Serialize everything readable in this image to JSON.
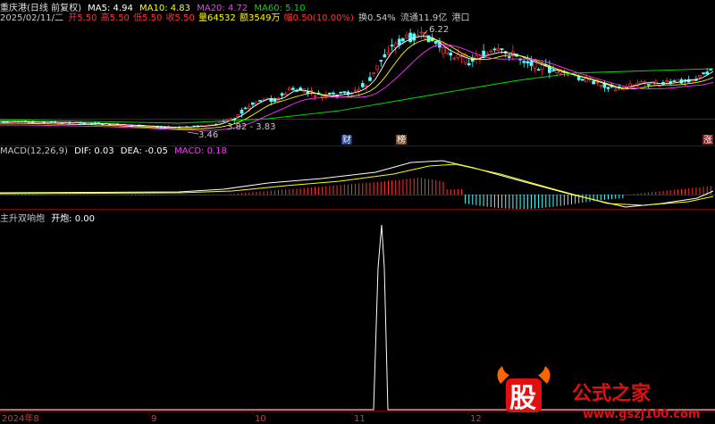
{
  "header": {
    "title": "重庆港(日线 前复权)",
    "ma": [
      {
        "label": "MA5: 4.94",
        "color": "#ffffff"
      },
      {
        "label": "MA10: 4.83",
        "color": "#ffff00"
      },
      {
        "label": "MA20: 4.72",
        "color": "#ff33ff"
      },
      {
        "label": "MA60: 5.10",
        "color": "#00e000"
      }
    ],
    "date": "2025/02/11/二",
    "open": "开5.50",
    "high": "高5.50",
    "low": "低5.50",
    "close": "收5.50",
    "volume": "量64532",
    "amount": "额3549万",
    "range": "幅0.50(10.00%)",
    "turnover": "换0.54%",
    "float": "流通11.9亿",
    "sector": "港口"
  },
  "price_annotations": {
    "high_label": "6.22",
    "low_label": "3.46",
    "mid_label": "3.82 - 3.83",
    "markers": [
      "财",
      "榜",
      "涨"
    ]
  },
  "macd": {
    "title": "MACD(12,26,9)",
    "dif": "DIF: 0.03",
    "dea": "DEA: -0.05",
    "macd": "MACD: 0.18"
  },
  "indicator": {
    "title": "主升双响炮",
    "value": "开炮: 0.00"
  },
  "x_axis": [
    "2024年8",
    "9",
    "10",
    "11",
    "12"
  ],
  "watermark": {
    "icon_text": "股",
    "brand": "公式之家",
    "url": "www.gszj100.com"
  },
  "colors": {
    "up": "#ff3333",
    "down": "#54ffff",
    "ma5": "#ffffff",
    "ma10": "#ffff00",
    "ma20": "#ff33ff",
    "ma60": "#00e000",
    "grid": "#800000"
  }
}
